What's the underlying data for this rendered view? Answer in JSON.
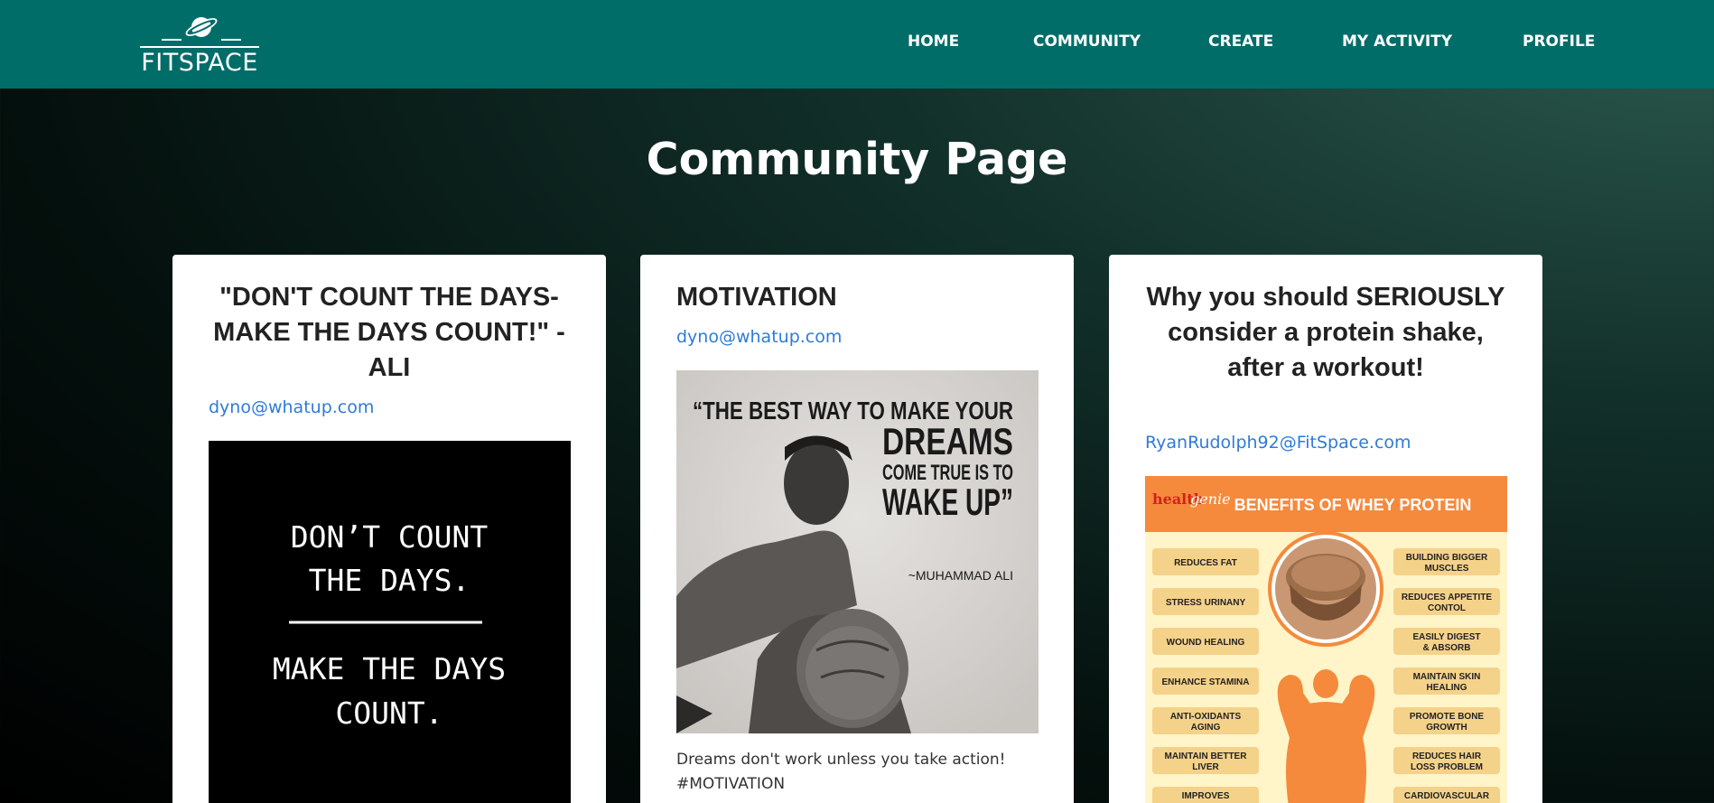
{
  "brand": {
    "name": "FITSPACE",
    "icon": "planet-icon"
  },
  "nav": {
    "home": "HOME",
    "community": "COMMUNITY",
    "create": "CREATE",
    "activity": "MY ACTIVITY",
    "profile": "PROFILE"
  },
  "page": {
    "title": "Community Page"
  },
  "colors": {
    "navbar": "#006d69",
    "link": "#2f7bd9",
    "infographic_accent": "#f58a3c"
  },
  "posts": [
    {
      "title": "\"DON'T COUNT THE DAYS- MAKE THE DAYS COUNT!\" - ALI",
      "author": "dyno@whatup.com",
      "image": {
        "line1": "DON’T COUNT",
        "line2": "THE DAYS.",
        "line3": "MAKE THE DAYS",
        "line4": "COUNT."
      }
    },
    {
      "title": "MOTIVATION",
      "author": "dyno@whatup.com",
      "image": {
        "line1": "“THE BEST WAY TO MAKE YOUR",
        "line2": "DREAMS",
        "line3": "COME TRUE IS TO",
        "line4": "WAKE UP”",
        "attribution": "~MUHAMMAD ALI"
      },
      "description": "Dreams don't work unless you take action! #MOTIVATION"
    },
    {
      "title": "Why you should SERIOUSLY consider a protein shake, after a workout!",
      "author": "RyanRudolph92@FitSpace.com",
      "image": {
        "brand_a": "health",
        "brand_b": "genie",
        "header": "BENEFITS OF WHEY PROTEIN",
        "left": [
          "REDUCES FAT",
          "STRESS URINANY",
          "WOUND HEALING",
          "ENHANCE STAMINA",
          "ANTI-OXIDANTS AGING",
          "MAINTAIN BETTER LIVER",
          "IMPROVES IMMUNITY"
        ],
        "right": [
          "BUILDING BIGGER MUSCLES",
          "REDUCES APPETITE CONTOL",
          "EASILY DIGEST & ABSORB",
          "MAINTAIN SKIN HEALING",
          "PROMOTE BONE GROWTH",
          "REDUCES HAIR LOSS PROBLEM",
          "CARDIOVASCULAR DISEASE"
        ]
      }
    }
  ]
}
